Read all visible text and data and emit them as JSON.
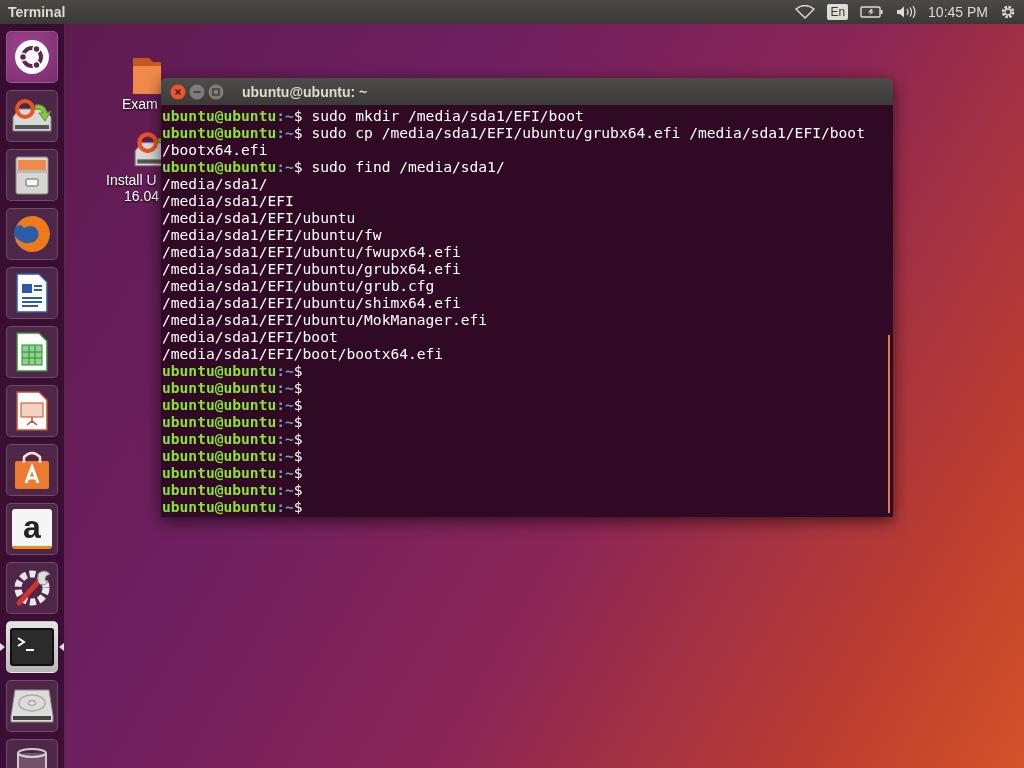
{
  "top_bar": {
    "app_title": "Terminal",
    "keyboard_layout": "En",
    "clock": "10:45 PM"
  },
  "launcher": [
    {
      "kind": "dash",
      "active": false
    },
    {
      "kind": "installer",
      "active": false
    },
    {
      "kind": "files",
      "active": false
    },
    {
      "kind": "browser",
      "active": false
    },
    {
      "kind": "writer",
      "active": false
    },
    {
      "kind": "calc",
      "active": false
    },
    {
      "kind": "impress",
      "active": false
    },
    {
      "kind": "software",
      "active": false
    },
    {
      "kind": "amazon",
      "active": false,
      "glyph": "a"
    },
    {
      "kind": "settings",
      "active": false
    },
    {
      "kind": "terminal",
      "active": true
    },
    {
      "kind": "drive",
      "active": false
    },
    {
      "kind": "trash",
      "active": false
    }
  ],
  "desktop_icons": [
    {
      "kind": "folder",
      "label": "Exam"
    },
    {
      "kind": "installer",
      "label": "Install U",
      "label_line2": "16.04"
    }
  ],
  "terminal": {
    "title": "ubuntu@ubuntu: ~",
    "lines": [
      {
        "user": "ubuntu@ubuntu",
        "path": ":~",
        "text": "$ sudo mkdir /media/sda1/EFI/boot"
      },
      {
        "user": "ubuntu@ubuntu",
        "path": ":~",
        "text": "$ sudo cp /media/sda1/EFI/ubuntu/grubx64.efi /media/sda1/EFI/boot"
      },
      {
        "text": "/bootx64.efi"
      },
      {
        "user": "ubuntu@ubuntu",
        "path": ":~",
        "text": "$ sudo find /media/sda1/"
      },
      {
        "text": "/media/sda1/"
      },
      {
        "text": "/media/sda1/EFI"
      },
      {
        "text": "/media/sda1/EFI/ubuntu"
      },
      {
        "text": "/media/sda1/EFI/ubuntu/fw"
      },
      {
        "text": "/media/sda1/EFI/ubuntu/fwupx64.efi"
      },
      {
        "text": "/media/sda1/EFI/ubuntu/grubx64.efi"
      },
      {
        "text": "/media/sda1/EFI/ubuntu/grub.cfg"
      },
      {
        "text": "/media/sda1/EFI/ubuntu/shimx64.efi"
      },
      {
        "text": "/media/sda1/EFI/ubuntu/MokManager.efi"
      },
      {
        "text": "/media/sda1/EFI/boot"
      },
      {
        "text": "/media/sda1/EFI/boot/bootx64.efi"
      },
      {
        "user": "ubuntu@ubuntu",
        "path": ":~",
        "text": "$"
      },
      {
        "user": "ubuntu@ubuntu",
        "path": ":~",
        "text": "$"
      },
      {
        "user": "ubuntu@ubuntu",
        "path": ":~",
        "text": "$"
      },
      {
        "user": "ubuntu@ubuntu",
        "path": ":~",
        "text": "$"
      },
      {
        "user": "ubuntu@ubuntu",
        "path": ":~",
        "text": "$"
      },
      {
        "user": "ubuntu@ubuntu",
        "path": ":~",
        "text": "$"
      },
      {
        "user": "ubuntu@ubuntu",
        "path": ":~",
        "text": "$"
      },
      {
        "user": "ubuntu@ubuntu",
        "path": ":~",
        "text": "$"
      },
      {
        "user": "ubuntu@ubuntu",
        "path": ":~",
        "text": "$"
      }
    ]
  }
}
